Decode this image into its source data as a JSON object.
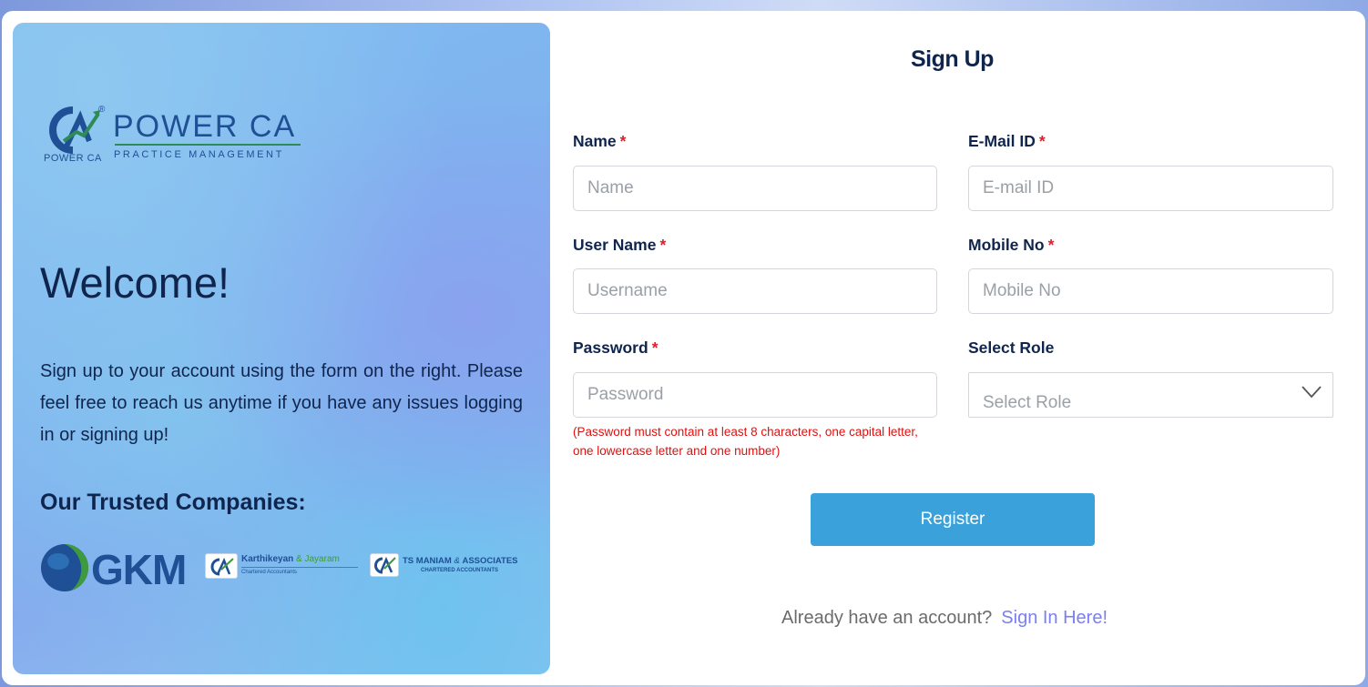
{
  "left": {
    "logo": {
      "brand": "POWER CA",
      "tagline": "PRACTICE MANAGEMENT",
      "mark_caption": "POWER CA",
      "registered": "®"
    },
    "welcome": "Welcome!",
    "intro": "Sign up to your account using the form on the right. Please feel free to reach us anytime if you have any issues logging in or signing up!",
    "trusted_heading": "Our Trusted Companies:",
    "companies": {
      "gkm": "GKM",
      "kj_name_a": "Karthikeyan",
      "kj_amp": " & ",
      "kj_name_b": "Jayaram",
      "kj_sub": "Chartered Accountants",
      "ts_name": "TS MANIAM",
      "ts_amp": " & ",
      "ts_assoc": "ASSOCIATES",
      "ts_sub": "CHARTERED ACCOUNTANTS"
    }
  },
  "form": {
    "title": "Sign Up",
    "required_mark": "*",
    "name": {
      "label": "Name",
      "placeholder": "Name"
    },
    "email": {
      "label": "E-Mail ID",
      "placeholder": "E-mail ID"
    },
    "username": {
      "label": "User Name",
      "placeholder": "Username"
    },
    "mobile": {
      "label": "Mobile No",
      "placeholder": "Mobile No"
    },
    "password": {
      "label": "Password",
      "placeholder": "Password",
      "hint": "(Password must contain at least 8 characters, one capital letter, one lowercase letter and one number)"
    },
    "role": {
      "label": "Select Role",
      "selected": "Select Role"
    },
    "register_label": "Register",
    "signin_prompt": "Already have an account?",
    "signin_link": "Sign In Here!"
  },
  "colors": {
    "primary_button": "#3aa1db",
    "link": "#7b7ff0",
    "required": "#e01e2a",
    "heading": "#10254d"
  }
}
